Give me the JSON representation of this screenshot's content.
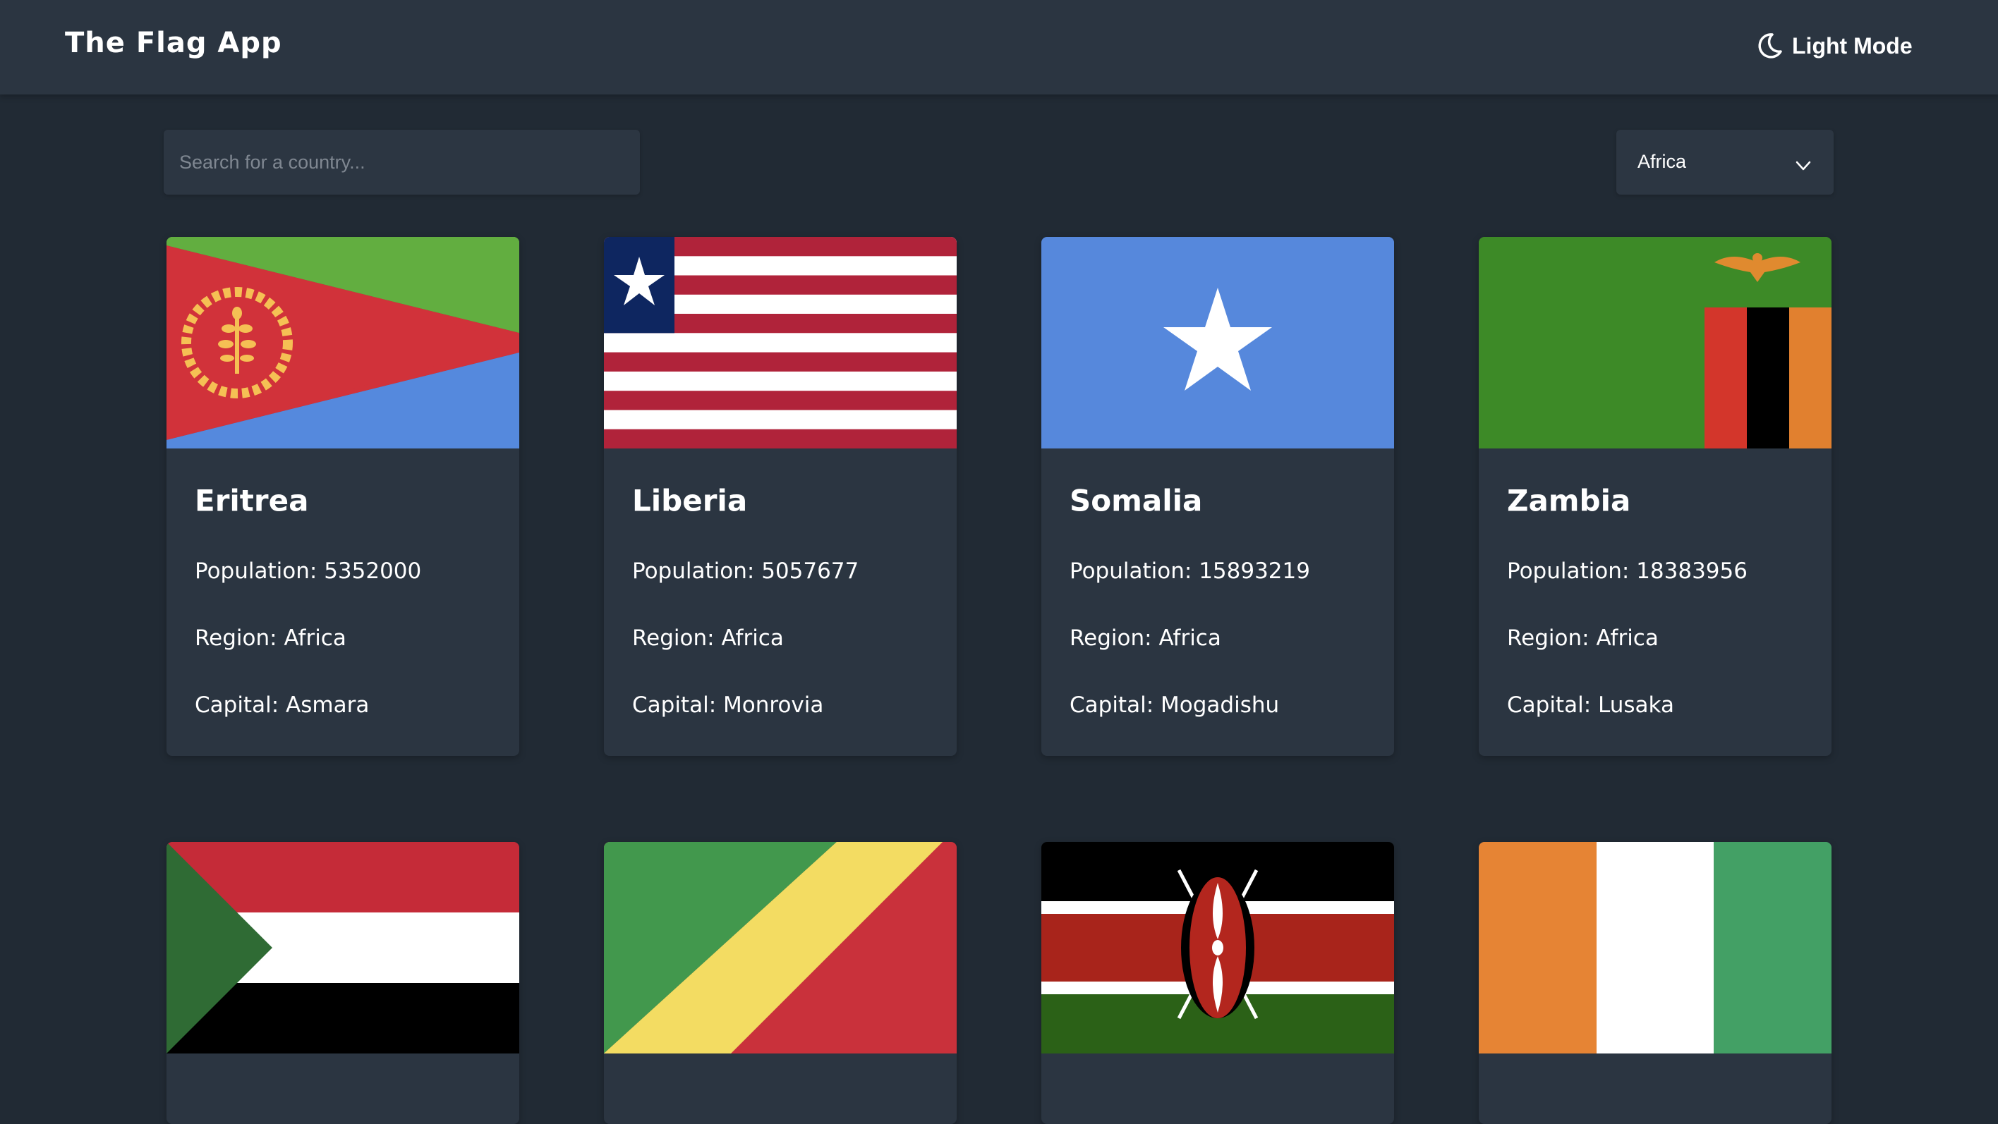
{
  "header": {
    "title": "The Flag App",
    "mode_label": "Light Mode",
    "mode_icon": "moon-icon"
  },
  "search": {
    "placeholder": "Search for a country...",
    "value": ""
  },
  "filter": {
    "selected": "Africa",
    "icon": "chevron-down-icon"
  },
  "labels": {
    "population": "Population:",
    "region": "Region:",
    "capital": "Capital:"
  },
  "countries": [
    {
      "name": "Eritrea",
      "population": "5352000",
      "region": "Africa",
      "capital": "Asmara",
      "flag": "eritrea-flag"
    },
    {
      "name": "Liberia",
      "population": "5057677",
      "region": "Africa",
      "capital": "Monrovia",
      "flag": "liberia-flag"
    },
    {
      "name": "Somalia",
      "population": "15893219",
      "region": "Africa",
      "capital": "Mogadishu",
      "flag": "somalia-flag"
    },
    {
      "name": "Zambia",
      "population": "18383956",
      "region": "Africa",
      "capital": "Lusaka",
      "flag": "zambia-flag"
    },
    {
      "flag": "sudan-flag"
    },
    {
      "flag": "republic-of-the-congo-flag"
    },
    {
      "flag": "kenya-flag"
    },
    {
      "flag": "ivory-coast-flag"
    }
  ],
  "colors": {
    "background": "#212a34",
    "surface": "#2b3541",
    "text": "#ffffff",
    "placeholder": "#7f8791"
  }
}
